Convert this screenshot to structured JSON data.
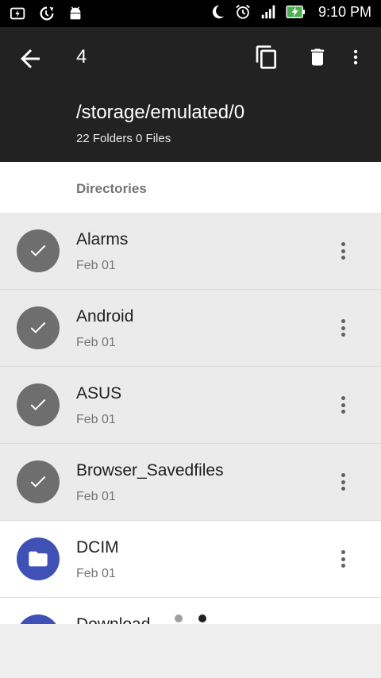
{
  "status_bar": {
    "time": "9:10 PM",
    "left_icons": [
      "flash-icon",
      "sync-icon",
      "android-icon"
    ],
    "right_icons": [
      "moon-icon",
      "alarm-icon",
      "signal-icon",
      "battery-charging-icon"
    ]
  },
  "toolbar": {
    "selected_count": "4",
    "path": "/storage/emulated/0",
    "counts": "22 Folders 0 Files",
    "actions": [
      "back-icon",
      "copy-icon",
      "delete-icon",
      "more-vert-icon"
    ]
  },
  "section": {
    "header": "Directories"
  },
  "items": [
    {
      "name": "Alarms",
      "date": "Feb 01",
      "selected": true
    },
    {
      "name": "Android",
      "date": "Feb 01",
      "selected": true
    },
    {
      "name": "ASUS",
      "date": "Feb 01",
      "selected": true
    },
    {
      "name": "Browser_Savedfiles",
      "date": "Feb 01",
      "selected": true
    },
    {
      "name": "DCIM",
      "date": "Feb 01",
      "selected": false
    },
    {
      "name": "Download",
      "date": "",
      "selected": false
    }
  ],
  "pager": {
    "pages": 2,
    "active_page": 2
  },
  "colors": {
    "toolbar_bg": "#222222",
    "selected_avatar": "#6e6e6e",
    "folder_avatar": "#3f51b5",
    "selected_row_bg": "#ebebeb"
  }
}
